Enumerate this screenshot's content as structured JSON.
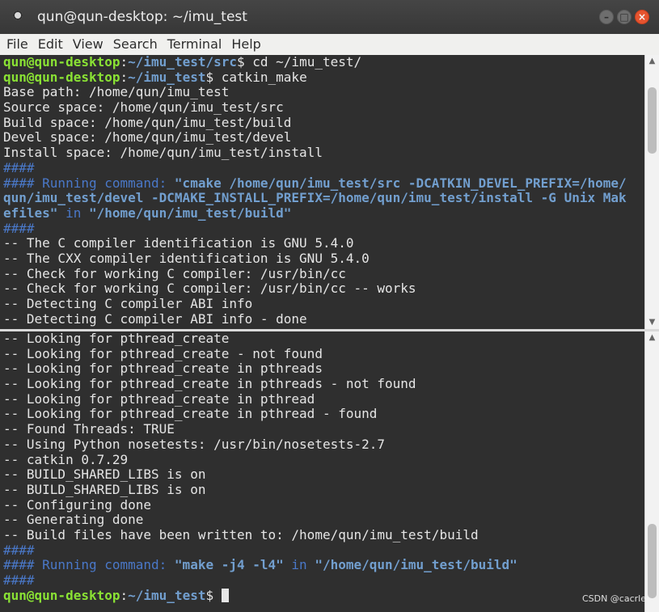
{
  "window": {
    "title": "qun@qun-desktop: ~/imu_test"
  },
  "menu": {
    "items": [
      "File",
      "Edit",
      "View",
      "Search",
      "Terminal",
      "Help"
    ]
  },
  "terminal": {
    "top": [
      {
        "kind": "prompt",
        "user": "qun@qun-desktop",
        "path": "~/imu_test/src",
        "cmd": " cd ~/imu_test/"
      },
      {
        "kind": "prompt",
        "user": "qun@qun-desktop",
        "path": "~/imu_test",
        "cmd": " catkin_make"
      },
      {
        "kind": "text",
        "text": "Base path: /home/qun/imu_test"
      },
      {
        "kind": "text",
        "text": "Source space: /home/qun/imu_test/src"
      },
      {
        "kind": "text",
        "text": "Build space: /home/qun/imu_test/build"
      },
      {
        "kind": "text",
        "text": "Devel space: /home/qun/imu_test/devel"
      },
      {
        "kind": "text",
        "text": "Install space: /home/qun/imu_test/install"
      },
      {
        "kind": "hash",
        "text": "####"
      },
      {
        "kind": "running",
        "prefix": "#### Running command: ",
        "quoted": "\"cmake /home/qun/imu_test/src -DCATKIN_DEVEL_PREFIX=/home/"
      },
      {
        "kind": "bold",
        "text": "qun/imu_test/devel -DCMAKE_INSTALL_PREFIX=/home/qun/imu_test/install -G Unix Mak"
      },
      {
        "kind": "running2",
        "bold1": "efiles\"",
        "mid": " in ",
        "bold2": "\"/home/qun/imu_test/build\""
      },
      {
        "kind": "hash",
        "text": "####"
      },
      {
        "kind": "text",
        "text": "-- The C compiler identification is GNU 5.4.0"
      },
      {
        "kind": "text",
        "text": "-- The CXX compiler identification is GNU 5.4.0"
      },
      {
        "kind": "text",
        "text": "-- Check for working C compiler: /usr/bin/cc"
      },
      {
        "kind": "text",
        "text": "-- Check for working C compiler: /usr/bin/cc -- works"
      },
      {
        "kind": "text",
        "text": "-- Detecting C compiler ABI info"
      },
      {
        "kind": "text",
        "text": "-- Detecting C compiler ABI info - done"
      }
    ],
    "bottom": [
      {
        "kind": "text",
        "text": "-- Looking for pthread_create"
      },
      {
        "kind": "text",
        "text": "-- Looking for pthread_create - not found"
      },
      {
        "kind": "text",
        "text": "-- Looking for pthread_create in pthreads"
      },
      {
        "kind": "text",
        "text": "-- Looking for pthread_create in pthreads - not found"
      },
      {
        "kind": "text",
        "text": "-- Looking for pthread_create in pthread"
      },
      {
        "kind": "text",
        "text": "-- Looking for pthread_create in pthread - found"
      },
      {
        "kind": "text",
        "text": "-- Found Threads: TRUE"
      },
      {
        "kind": "text",
        "text": "-- Using Python nosetests: /usr/bin/nosetests-2.7"
      },
      {
        "kind": "text",
        "text": "-- catkin 0.7.29"
      },
      {
        "kind": "text",
        "text": "-- BUILD_SHARED_LIBS is on"
      },
      {
        "kind": "text",
        "text": "-- BUILD_SHARED_LIBS is on"
      },
      {
        "kind": "text",
        "text": "-- Configuring done"
      },
      {
        "kind": "text",
        "text": "-- Generating done"
      },
      {
        "kind": "text",
        "text": "-- Build files have been written to: /home/qun/imu_test/build"
      },
      {
        "kind": "hash",
        "text": "####"
      },
      {
        "kind": "running3",
        "prefix": "#### Running command: ",
        "bold1": "\"make -j4 -l4\"",
        "mid": " in ",
        "bold2": "\"/home/qun/imu_test/build\""
      },
      {
        "kind": "hash",
        "text": "####"
      },
      {
        "kind": "prompt",
        "user": "qun@qun-desktop",
        "path": "~/imu_test",
        "cmd": " ",
        "cursor": true
      }
    ]
  },
  "watermark": "CSDN @cacrle",
  "colors": {
    "prompt_user": "#8ae234",
    "prompt_path": "#729fcf",
    "info_blue": "#4a78c8",
    "background": "#2f2f2f",
    "text": "#e5e5e5"
  }
}
